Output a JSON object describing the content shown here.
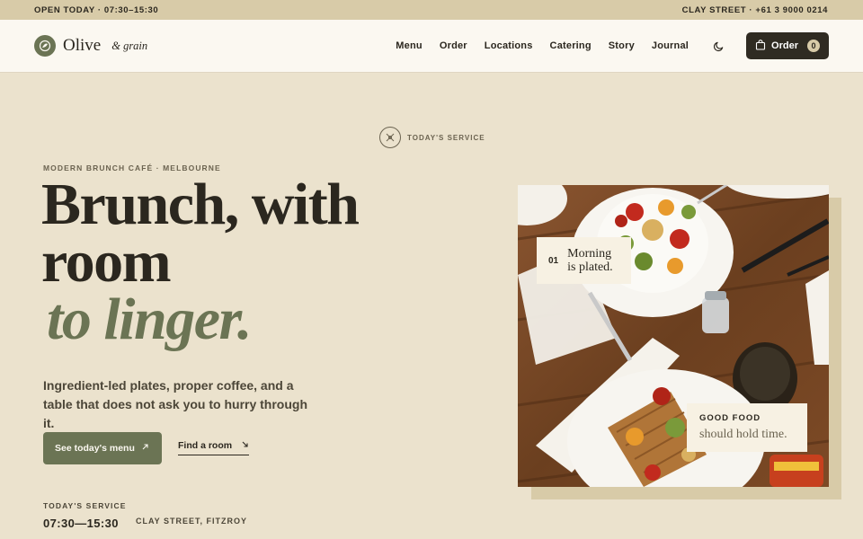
{
  "topbar": {
    "hours": "OPEN TODAY · 07:30–15:30",
    "contact": "CLAY STREET · +61 3 9000 0214"
  },
  "brand": {
    "name": "Olive",
    "sub": "& grain"
  },
  "nav": {
    "items": [
      {
        "label": "Menu"
      },
      {
        "label": "Order"
      },
      {
        "label": "Locations"
      },
      {
        "label": "Catering"
      },
      {
        "label": "Story"
      },
      {
        "label": "Journal"
      }
    ],
    "theme_icon": "moon-icon",
    "order_button": {
      "label": "Order",
      "count": "0",
      "icon": "shopping-bag-icon"
    }
  },
  "badge": {
    "label": "TODAY'S SERVICE",
    "icon": "cutlery-icon"
  },
  "hero": {
    "eyebrow": "MODERN BRUNCH CAFÉ · MELBOURNE",
    "headline_line1": "Brunch, with",
    "headline_line2": "room",
    "headline_line3": "to linger.",
    "lede": "Ingredient-led plates, proper coffee, and a table that does not ask you to hurry through it.",
    "primary_cta": "See today's menu",
    "secondary_cta": "Find a room"
  },
  "service": {
    "title": "TODAY'S SERVICE",
    "hours": "07:30—15:30",
    "location": "CLAY STREET, FITZROY"
  },
  "photo": {
    "caption1_number": "01",
    "caption1_line1": "Morning",
    "caption1_line2": "is plated.",
    "caption2_title": "GOOD FOOD",
    "caption2_text": "should hold time."
  },
  "colors": {
    "background": "#ebe2cd",
    "topbar": "#d8cba8",
    "header": "#fbf8f1",
    "olive": "#6b7454",
    "dark": "#2f2b22"
  }
}
